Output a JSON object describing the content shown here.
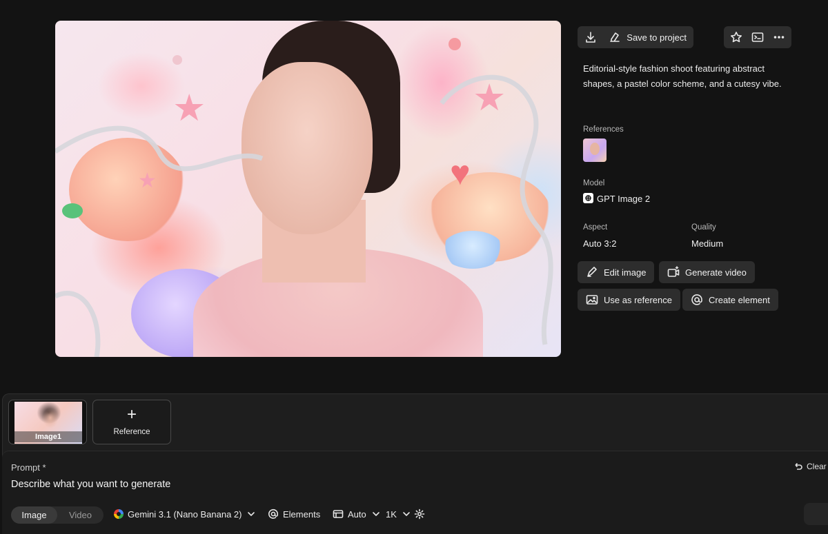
{
  "toolbar": {
    "download_icon": "download-icon",
    "save_label": "Save to project",
    "favorite_icon": "star-icon",
    "terminal_icon": "terminal-icon",
    "more_icon": "more-icon"
  },
  "details": {
    "description": "Editorial-style fashion shoot featuring abstract shapes, a pastel color scheme, and a cutesy vibe.",
    "references_label": "References",
    "model_label": "Model",
    "model_value": "GPT Image 2",
    "aspect_label": "Aspect",
    "aspect_value": "Auto 3:2",
    "quality_label": "Quality",
    "quality_value": "Medium"
  },
  "actions": {
    "edit_image": "Edit image",
    "generate_video": "Generate video",
    "use_as_reference": "Use as reference",
    "create_element": "Create element"
  },
  "composer": {
    "thumb_label": "Image1",
    "reference_label": "Reference",
    "prompt_label": "Prompt *",
    "prompt_placeholder": "Describe what you want to generate",
    "clear_label": "Clear a",
    "mode_image": "Image",
    "mode_video": "Video",
    "model_select": "Gemini 3.1 (Nano Banana 2)",
    "elements_label": "Elements",
    "aspect_select": "Auto",
    "resolution_select": "1K"
  },
  "colors": {
    "background": "#131313",
    "button_bg": "#2d2d2d",
    "composer_bg": "#1b1b1b"
  }
}
